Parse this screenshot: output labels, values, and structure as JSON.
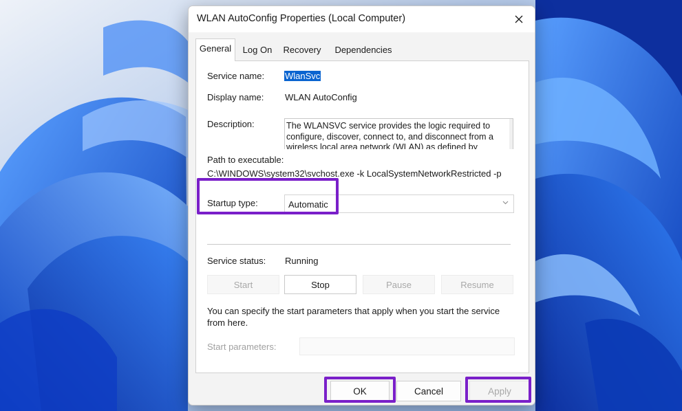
{
  "window": {
    "title": "WLAN AutoConfig Properties (Local Computer)",
    "close_icon": "close-icon"
  },
  "tabs": [
    {
      "label": "General",
      "active": true
    },
    {
      "label": "Log On",
      "active": false
    },
    {
      "label": "Recovery",
      "active": false
    },
    {
      "label": "Dependencies",
      "active": false
    }
  ],
  "general": {
    "service_name_label": "Service name:",
    "service_name_value": "WlanSvc",
    "display_name_label": "Display name:",
    "display_name_value": "WLAN AutoConfig",
    "description_label": "Description:",
    "description_value": "The WLANSVC service provides the logic required to configure, discover, connect to, and disconnect from a wireless local area network (WLAN) as defined by",
    "path_label": "Path to executable:",
    "path_value": "C:\\WINDOWS\\system32\\svchost.exe -k LocalSystemNetworkRestricted -p",
    "startup_type_label": "Startup type:",
    "startup_type_value": "Automatic",
    "service_status_label": "Service status:",
    "service_status_value": "Running",
    "buttons": {
      "start": "Start",
      "stop": "Stop",
      "pause": "Pause",
      "resume": "Resume"
    },
    "params_note": "You can specify the start parameters that apply when you start the service from here.",
    "start_parameters_label": "Start parameters:",
    "start_parameters_value": ""
  },
  "footer": {
    "ok": "OK",
    "cancel": "Cancel",
    "apply": "Apply"
  },
  "colors": {
    "highlight": "#7a1fc9",
    "selection": "#0a64d0",
    "wallpaper": "#1d5fd6"
  }
}
